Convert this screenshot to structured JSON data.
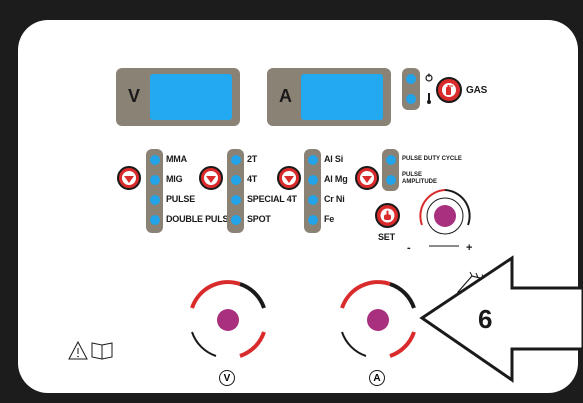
{
  "displays": {
    "voltage_label": "V",
    "current_label": "A"
  },
  "gas": {
    "label": "GAS"
  },
  "process_menu": {
    "items": [
      "MMA",
      "MIG",
      "PULSE",
      "DOUBLE PULSE"
    ]
  },
  "trigger_menu": {
    "items": [
      "2T",
      "4T",
      "SPECIAL 4T",
      "SPOT"
    ]
  },
  "material_menu": {
    "items": [
      "Al Si",
      "Al Mg",
      "Cr Ni",
      "Fe"
    ]
  },
  "pulse_menu": {
    "duty_cycle": "PULSE DUTY CYCLE",
    "amplitude_line1": "PULSE",
    "amplitude_line2": "AMPLITUDE"
  },
  "set_button": {
    "label": "SET"
  },
  "adjust_knob": {
    "minus": "-",
    "plus": "+"
  },
  "main_knobs": {
    "voltage_label": "V",
    "current_label": "A"
  },
  "callout": {
    "number": "6"
  },
  "colors": {
    "lcd": "#22a9ef",
    "accent_red": "#d92b2b",
    "knob_center": "#a8307f",
    "lcd_frame": "#8a8275"
  }
}
